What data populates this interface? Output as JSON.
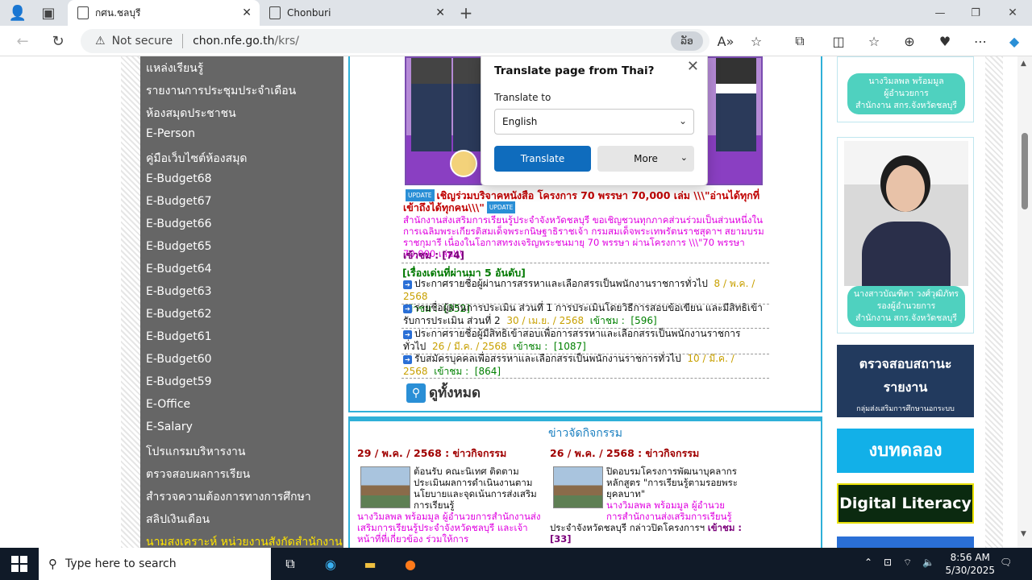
{
  "browser": {
    "tabs": [
      {
        "label": "กศน.ชลบุรี",
        "active": true
      },
      {
        "label": "Chonburi",
        "active": false
      }
    ],
    "new_tab": "+",
    "not_secure": "Not secure",
    "url_host": "chon.nfe.go.th",
    "url_path": "/krs/",
    "translate_pill": "ລັອ",
    "window_controls": {
      "minimize": "—",
      "restore": "❐",
      "close": "✕"
    }
  },
  "translate_popup": {
    "title": "Translate page from Thai?",
    "translate_to_label": "Translate to",
    "language": "English",
    "translate_button": "Translate",
    "more_button": "More"
  },
  "sidebar": {
    "items": [
      "แหล่งเรียนรู้",
      "รายงานการประชุมประจำเดือน",
      "ห้องสมุดประชาชน",
      "E-Person",
      "คู่มือเว็บไซต์ห้องสมุด",
      "E-Budget68",
      "E-Budget67",
      "E-Budget66",
      "E-Budget65",
      "E-Budget64",
      "E-Budget63",
      "E-Budget62",
      "E-Budget61",
      "E-Budget60",
      "E-Budget59",
      "E-Office",
      "E-Salary",
      "โปรแกรมบริหารงาน",
      "ตรวจสอบผลการเรียน",
      "สำรวจความต้องการทางการศึกษา",
      "สลิปเงินเดือน",
      "นามสงเคราะห์ หน่วยงานสังกัดสำนักงาน"
    ]
  },
  "main": {
    "update_badge": "UPDATE",
    "headline": "เชิญร่วมบริจาคหนังสือ โครงการ 70 พรรษา 70,000 เล่ม \\\\\\\"อ่านได้ทุกที่ เข้าถึงได้ทุกคน\\\\\\\"",
    "headline_body": "สำนักงานส่งเสริมการเรียนรู้ประจำจังหวัดชลบุรี ขอเชิญชวนทุกภาคส่วนร่วมเป็นส่วนหนึ่งในการเฉลิมพระเกียรติสมเด็จพระกนิษฐาธิราชเจ้า กรมสมเด็จพระเทพรัตนราชสุดาฯ สยามบรมราชกุมารี เนื่องในโอกาสทรงเจริญพระชนมายุ 70 พรรษา ผ่านโครงการ \\\\\\\"70 พรรษา 70,000 เล่ม\\\\\\",
    "headline_views_label": "เข้าชม :",
    "headline_views": "[74]",
    "section_title": "[เรื่องเด่นที่ผ่านมา 5 อันดับ]",
    "items": [
      {
        "text": "ประกาศรายชื่อผู้ผ่านการสรรหาและเลือกสรรเป็นพนักงานราชการทั่วไป",
        "date": "8 / พ.ค. / 2568",
        "views_label": "เข้าชม :",
        "views": "[352]"
      },
      {
        "text": "รายชื่อผู้ผ่านการประเมิน ส่วนที่ 1 การประเมินโดยวิธีการสอบข้อเขียน และมีสิทธิเข้ารับการประเมิน ส่วนที่ 2",
        "date": "30 / เม.ย. / 2568",
        "views_label": "เข้าชม :",
        "views": "[596]"
      },
      {
        "text": "ประกาศรายชื่อผู้มีสิทธิเข้าสอบเพื่อการสรรหาและเลือกสรรเป็นพนักงานราชการทั่วไป",
        "date": "26 / มี.ค. / 2568",
        "views_label": "เข้าชม :",
        "views": "[1087]"
      },
      {
        "text": "รับสมัครบุคคลเพื่อสรรหาและเลือกสรรเป็นพนักงานราชการทั่วไป",
        "date": "10 / มี.ค. / 2568",
        "views_label": "เข้าชม :",
        "views": "[864]"
      }
    ],
    "view_all": "ดูทั้งหมด",
    "activity_title": "ข่าวจัดกิจกรรม",
    "activities": [
      {
        "date": "29 / พ.ค. / 2568 : ข่าวกิจกรรม",
        "title": "ต้อนรับ คณะนิเทศ ติดตาม ประเมินผลการดำเนินงานตามนโยบายและจุดเน้นการส่งเสริมการเรียนรู้",
        "sub": "นางวิมลพล พร้อมมูล ผู้อำนวยการสำนักงานส่งเสริมการเรียนรู้ประจำจังหวัดชลบุรี และเจ้าหน้าที่ที่เกี่ยวข้อง ร่วมให้การ"
      },
      {
        "date": "26 / พ.ค. / 2568 : ข่าวกิจกรรม",
        "title": "ปิดอบรมโครงการพัฒนาบุคลากร หลักสูตร \"การเรียนรู้ตามรอยพระยุคลบาท\"",
        "sub": "นางวิมลพล พร้อมมูล ผู้อำนวยการสำนักงานส่งเสริมการเรียนรู้",
        "tail": "ประจำจังหวัดชลบุรี กล่าวปิดโครงการฯ",
        "views_label": "เข้าชม :",
        "views": "[33]"
      }
    ]
  },
  "right": {
    "card1_caption": [
      "นางวิมลพล พร้อมมูล",
      "ผู้อำนวยการ",
      "สำนักงาน สกร.จังหวัดชลบุรี"
    ],
    "card2_caption": [
      "นางสาวบัณฑิตา วงศ์วุฒิภัทร",
      "รองผู้อำนวยการ",
      "สำนักงาน สกร.จังหวัดชลบุรี"
    ],
    "btn_status_line1": "ตรวจสอบสถานะ",
    "btn_status_line2": "รายงาน",
    "btn_status_sub": "กลุ่มส่งเสริมการศึกษานอกระบบ",
    "btn_test": "งบทดลอง",
    "btn_digital": "Digital Literacy"
  },
  "taskbar": {
    "search_placeholder": "Type here to search",
    "time": "8:56 AM",
    "date": "5/30/2025"
  }
}
